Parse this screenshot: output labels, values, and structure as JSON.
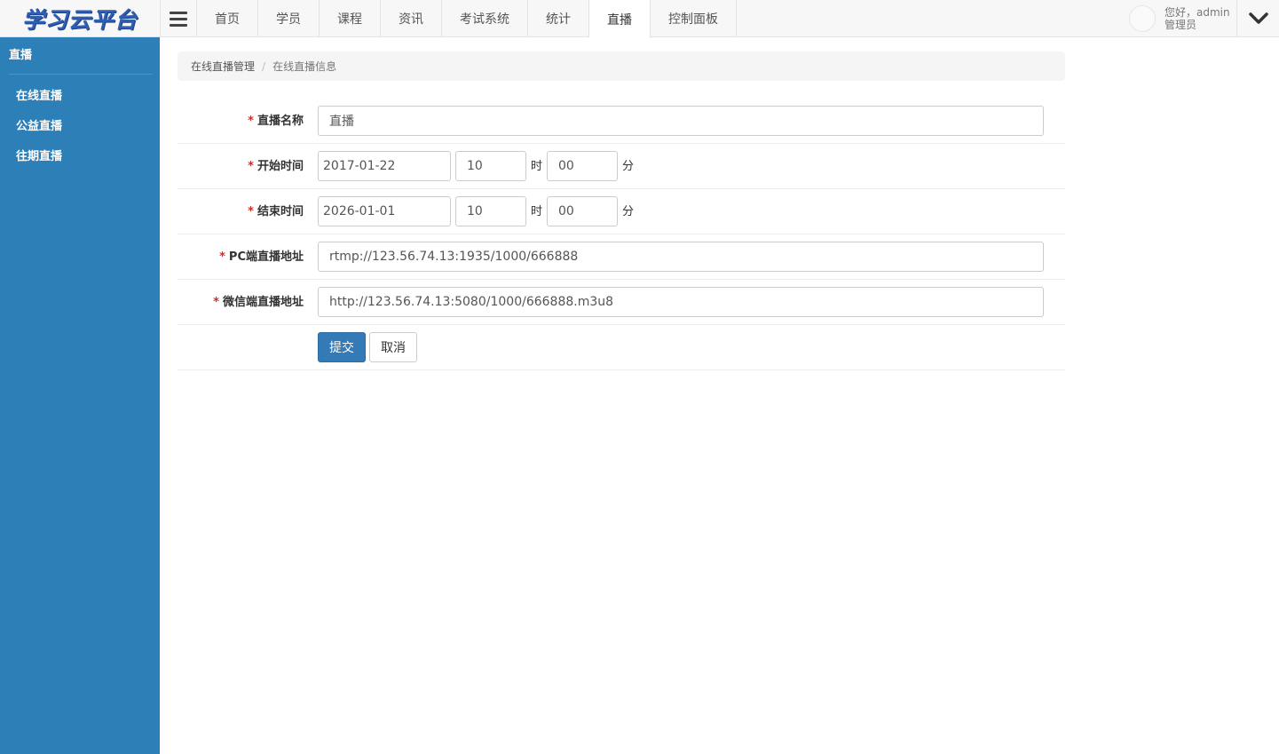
{
  "app": {
    "logo_text": "学习云平台"
  },
  "nav": {
    "items": [
      {
        "label": "首页"
      },
      {
        "label": "学员"
      },
      {
        "label": "课程"
      },
      {
        "label": "资讯"
      },
      {
        "label": "考试系统"
      },
      {
        "label": "统计"
      },
      {
        "label": "直播",
        "active": true
      },
      {
        "label": "控制面板"
      }
    ]
  },
  "user": {
    "greeting": "您好，admin",
    "role": "管理员"
  },
  "sidebar": {
    "title": "直播",
    "items": [
      {
        "label": "在线直播"
      },
      {
        "label": "公益直播"
      },
      {
        "label": "往期直播"
      }
    ]
  },
  "breadcrumb": {
    "parent": "在线直播管理",
    "separator": "/",
    "current": "在线直播信息"
  },
  "form": {
    "required_mark": "*",
    "name": {
      "label": "直播名称",
      "value": "直播"
    },
    "start": {
      "label": "开始时间",
      "date": "2017-01-22",
      "hour": "10",
      "minute": "00"
    },
    "end": {
      "label": "结束时间",
      "date": "2026-01-01",
      "hour": "10",
      "minute": "00"
    },
    "hour_unit": "时",
    "minute_unit": "分",
    "pc_url": {
      "label": "PC端直播地址",
      "value": "rtmp://123.56.74.13:1935/1000/666888"
    },
    "wechat_url": {
      "label": "微信端直播地址",
      "value": "http://123.56.74.13:5080/1000/666888.m3u8"
    },
    "submit_label": "提交",
    "cancel_label": "取消"
  },
  "colors": {
    "sidebar_bg": "#2d7fb8",
    "primary_button": "#337ab7",
    "required_mark": "#c9302c",
    "logo": "#2f5fb3"
  },
  "icons": {
    "menu": "hamburger-icon",
    "dropdown": "chevron-down-icon"
  }
}
